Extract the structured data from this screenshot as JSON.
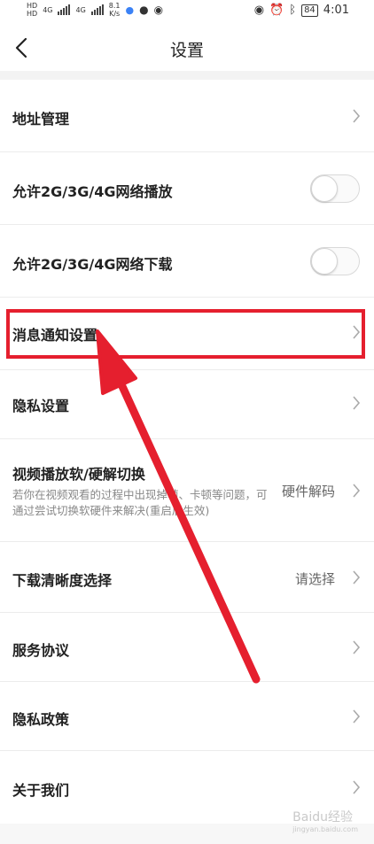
{
  "status_bar": {
    "hd1": "HD",
    "hd2": "HD",
    "net1": "4G",
    "net2": "4G",
    "speed_value": "8.1",
    "speed_unit": "K/s",
    "battery": "84",
    "time": "4:01"
  },
  "header": {
    "title": "设置"
  },
  "rows": [
    {
      "label": "地址管理"
    },
    {
      "label": "允许2G/3G/4G网络播放",
      "toggle_on": false
    },
    {
      "label": "允许2G/3G/4G网络下载",
      "toggle_on": false
    },
    {
      "label": "消息通知设置"
    },
    {
      "label": "隐私设置"
    },
    {
      "label": "视频播放软/硬解切换",
      "value": "硬件解码",
      "description": "若你在视频观看的过程中出现掉帧、卡顿等问题，可通过尝试切换软硬件来解决(重启后生效)"
    },
    {
      "label": "下载清晰度选择",
      "value": "请选择"
    },
    {
      "label": "服务协议"
    },
    {
      "label": "隐私政策"
    },
    {
      "label": "关于我们"
    }
  ],
  "annotation": {
    "highlight_color": "#e51f2e"
  },
  "watermark": {
    "text": "Baidu经验",
    "sub": "jingyan.baidu.com"
  }
}
